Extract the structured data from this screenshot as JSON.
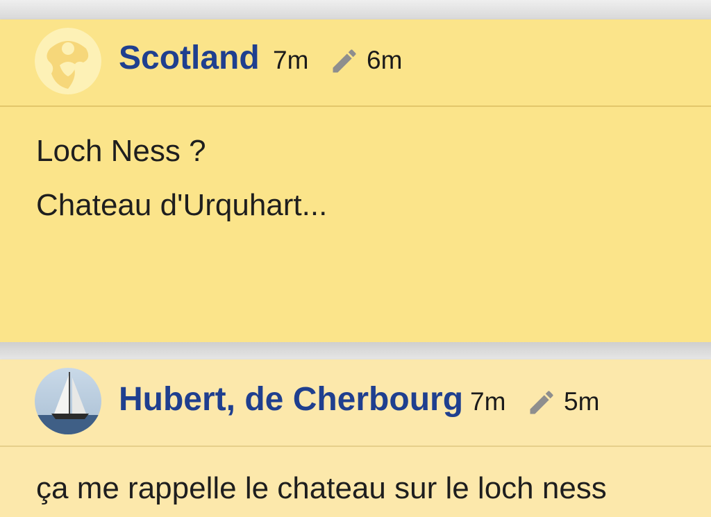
{
  "posts": [
    {
      "author": "Scotland",
      "posted_ago": "7m",
      "edited_ago": "6m",
      "avatar_icon": "scotland-avatar-icon",
      "lines": [
        "Loch Ness ?",
        "Chateau d'Urquhart..."
      ]
    },
    {
      "author": "Hubert, de Cherbourg",
      "posted_ago": "7m",
      "edited_ago": "5m",
      "avatar_icon": "sailboat-avatar-icon",
      "lines": [
        "ça me rappelle le chateau sur le loch ness"
      ]
    }
  ],
  "colors": {
    "card_highlight": "#fbe48a",
    "card_default": "#fce8ab",
    "author_name": "#1f3f8f",
    "edit_icon": "#8e8e8e"
  }
}
